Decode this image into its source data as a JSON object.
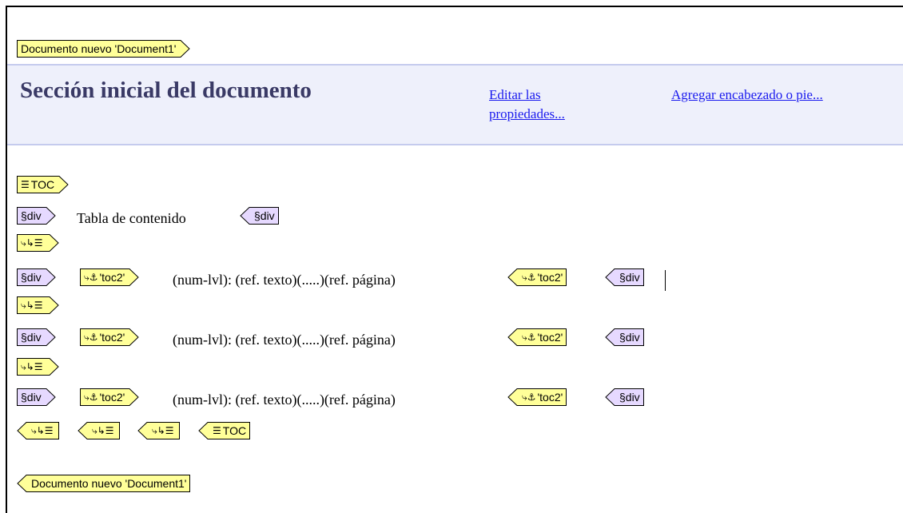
{
  "document": {
    "start_tag": "Documento nuevo 'Document1'",
    "end_tag": "Documento nuevo 'Document1'"
  },
  "section": {
    "title": "Sección inicial del documento",
    "edit_link": "Editar las propiedades...",
    "edit_link_line1": "Editar las",
    "edit_link_line2": "propiedades...",
    "header_footer_link": "Agregar encabezado o pie..."
  },
  "toc": {
    "label": "TOC",
    "div_label": "§div",
    "title_text": "Tabla de contenido",
    "bookmark_label": "'toc2'",
    "entry_text": "(num-lvl): (ref. texto)(.....)(ref. página)",
    "level_icon": "⤷↳☰"
  },
  "colors": {
    "tag_yellow": "#ffff99",
    "tag_purple": "#e6d9ff",
    "header_band": "#eef0fb",
    "link": "#1a1aee",
    "title": "#3a3a66"
  },
  "icons": {
    "toc": "list-icon",
    "anchor": "anchor-icon",
    "level": "level-icon"
  }
}
